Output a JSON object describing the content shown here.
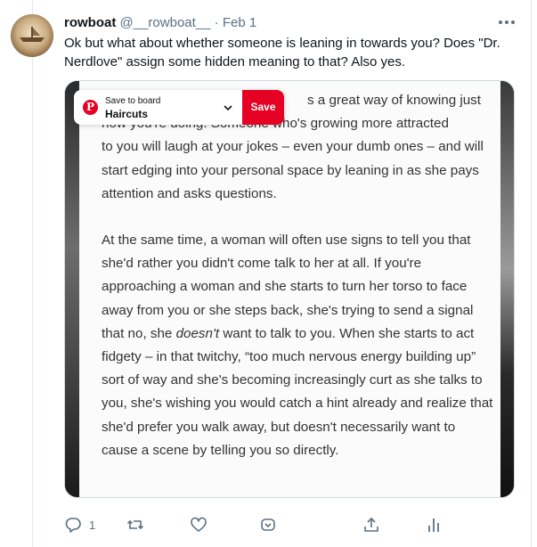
{
  "tweet": {
    "author_name": "rowboat",
    "handle": "@__rowboat__",
    "separator": "·",
    "date": "Feb 1",
    "text": "Ok but what about whether someone is leaning in towards you? Does \"Dr. Nerdlove\" assign some hidden meaning to that? Also yes."
  },
  "pinterest": {
    "save_to_board": "Save to board",
    "board_name": "Haircuts",
    "save_label": "Save"
  },
  "article": {
    "p1_visible_right": "s a great way of knowing just",
    "p1_line2": "how you're doing. Someone who's growing more attracted",
    "p1_rest": "to you will laugh at your jokes – even your dumb ones – and will start edging into your personal space by leaning in as she pays attention and asks questions.",
    "p2_a": "At the same time, a woman will often use signs to tell you that she'd rather you didn't come talk to her at all. If you're approaching a woman and she starts to turn her torso to face away from you or she steps back, she's trying to send a signal that no, she ",
    "p2_em": "doesn't",
    "p2_b": " want to talk to you. When she starts to act fidgety – in that twitchy, “too much nervous energy building up” sort of way and she's becoming increasingly curt as she talks to you, she's wishing you would catch a hint already and realize that she'd prefer you walk away, but doesn't necessarily want to cause a scene by telling you so directly."
  },
  "actions": {
    "reply_count": "1",
    "icons": [
      "reply-icon",
      "retweet-icon",
      "like-icon",
      "tip-icon",
      "share-icon",
      "analytics-icon"
    ]
  },
  "colors": {
    "text": "#0f1419",
    "secondary": "#5b7083",
    "pinterest_red": "#e60023",
    "border": "#e1e8ed"
  }
}
